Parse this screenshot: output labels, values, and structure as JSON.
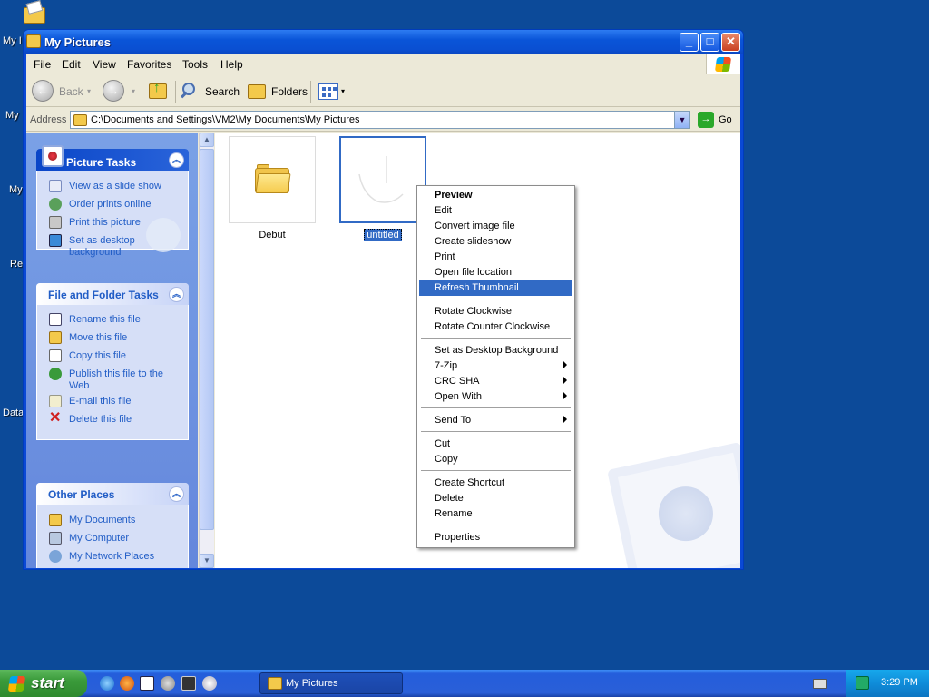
{
  "desktop": {
    "labels": [
      "My I",
      "My",
      "My",
      "Re",
      "Data"
    ]
  },
  "window": {
    "title": "My Pictures",
    "menu": [
      "File",
      "Edit",
      "View",
      "Favorites",
      "Tools",
      "Help"
    ],
    "toolbar": {
      "back": "Back",
      "search": "Search",
      "folders": "Folders"
    },
    "address": {
      "label": "Address",
      "value": "C:\\Documents and Settings\\VM2\\My Documents\\My Pictures",
      "go": "Go"
    }
  },
  "taskpane": {
    "picture_tasks": {
      "title": "Picture Tasks",
      "items": [
        "View as a slide show",
        "Order prints online",
        "Print this picture",
        "Set as desktop background"
      ]
    },
    "file_folder_tasks": {
      "title": "File and Folder Tasks",
      "items": [
        "Rename this file",
        "Move this file",
        "Copy this file",
        "Publish this file to the Web",
        "E-mail this file",
        "Delete this file"
      ]
    },
    "other_places": {
      "title": "Other Places",
      "items": [
        "My Documents",
        "My Computer",
        "My Network Places"
      ]
    }
  },
  "content": {
    "items": [
      {
        "name": "Debut",
        "selected": false
      },
      {
        "name": "untitled",
        "selected": true
      }
    ]
  },
  "context_menu": {
    "items": [
      {
        "label": "Preview",
        "bold": true
      },
      {
        "label": "Edit"
      },
      {
        "label": "Convert image file"
      },
      {
        "label": "Create slideshow"
      },
      {
        "label": "Print"
      },
      {
        "label": "Open file location"
      },
      {
        "label": "Refresh Thumbnail",
        "highlighted": true
      },
      {
        "label": "Rotate Clockwise"
      },
      {
        "label": "Rotate Counter Clockwise"
      },
      {
        "label": "Set as Desktop Background"
      },
      {
        "label": "7-Zip",
        "submenu": true
      },
      {
        "label": "CRC SHA",
        "submenu": true
      },
      {
        "label": "Open With",
        "submenu": true
      },
      {
        "label": "Send To",
        "submenu": true
      },
      {
        "label": "Cut"
      },
      {
        "label": "Copy"
      },
      {
        "label": "Create Shortcut"
      },
      {
        "label": "Delete"
      },
      {
        "label": "Rename"
      },
      {
        "label": "Properties"
      }
    ]
  },
  "taskbar": {
    "start": "start",
    "window_button": "My Pictures",
    "clock": "3:29 PM"
  },
  "colors": {
    "desktop": "#0c4a99",
    "selection": "#316ac5",
    "task_link": "#215dc6"
  }
}
